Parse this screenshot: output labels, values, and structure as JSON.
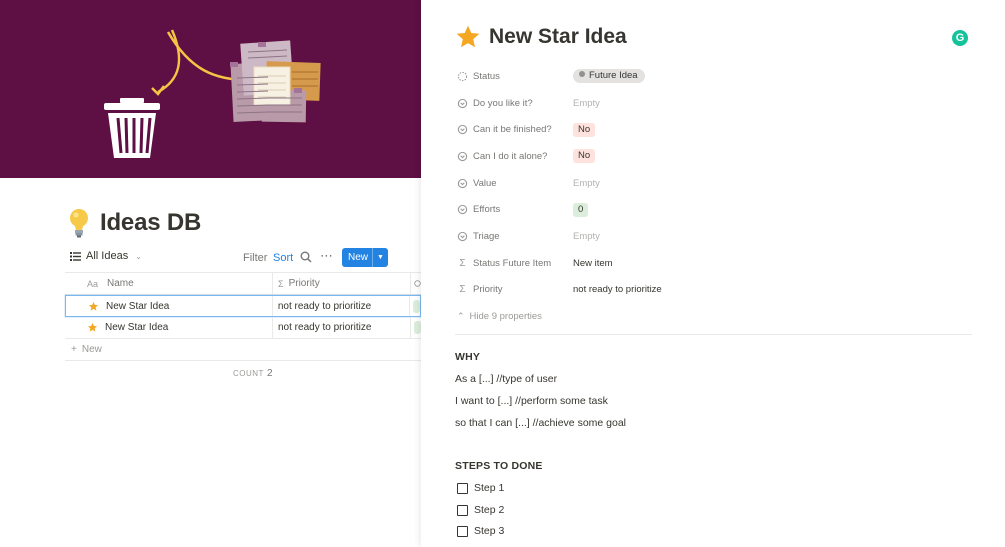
{
  "database": {
    "title": "Ideas DB",
    "view": {
      "label": "All Ideas"
    },
    "toolbar": {
      "filter": "Filter",
      "sort": "Sort",
      "more": "⋯",
      "new": "New"
    },
    "columns": [
      {
        "icon": "Aa",
        "label": "Name"
      },
      {
        "icon": "Σ",
        "label": "Priority"
      }
    ],
    "rows": [
      {
        "name": "New Star Idea",
        "priority": "not ready to prioritize"
      },
      {
        "name": "New Star Idea",
        "priority": "not ready to prioritize"
      }
    ],
    "add_row": "New",
    "count": {
      "label": "COUNT",
      "value": "2"
    }
  },
  "page": {
    "title": "New Star Idea",
    "properties": [
      {
        "name": "Status",
        "value": "Future Idea"
      },
      {
        "name": "Do you like it?",
        "value": "Empty"
      },
      {
        "name": "Can it be finished?",
        "value": "No"
      },
      {
        "name": "Can I do it alone?",
        "value": "No"
      },
      {
        "name": "Value",
        "value": "Empty"
      },
      {
        "name": "Efforts",
        "value": "0"
      },
      {
        "name": "Triage",
        "value": "Empty"
      },
      {
        "name": "Status Future Item",
        "value": "New item"
      },
      {
        "name": "Priority",
        "value": "not ready to prioritize"
      }
    ],
    "hide_properties": "Hide 9 properties",
    "why": {
      "heading": "WHY",
      "lines": [
        "As a [...] //type of user",
        "I want to [...] //perform some task",
        "so that I can [...] //achieve some goal"
      ]
    },
    "steps": {
      "heading": "STEPS TO DONE",
      "items": [
        "Step 1",
        "Step 2",
        "Step 3"
      ]
    }
  },
  "colors": {
    "cover": "#5e0f43",
    "accent": "#2383e2",
    "star": "#f5a623",
    "tag_red": "#ffe2dd",
    "tag_green": "#dbeddb",
    "tag_gray": "#e3e2e0",
    "grammarly": "#15c39a"
  },
  "icons": {
    "cover": "trash-and-notes-illustration",
    "title": "lightbulb-icon",
    "row": "star-icon",
    "extension": "grammarly-icon"
  }
}
